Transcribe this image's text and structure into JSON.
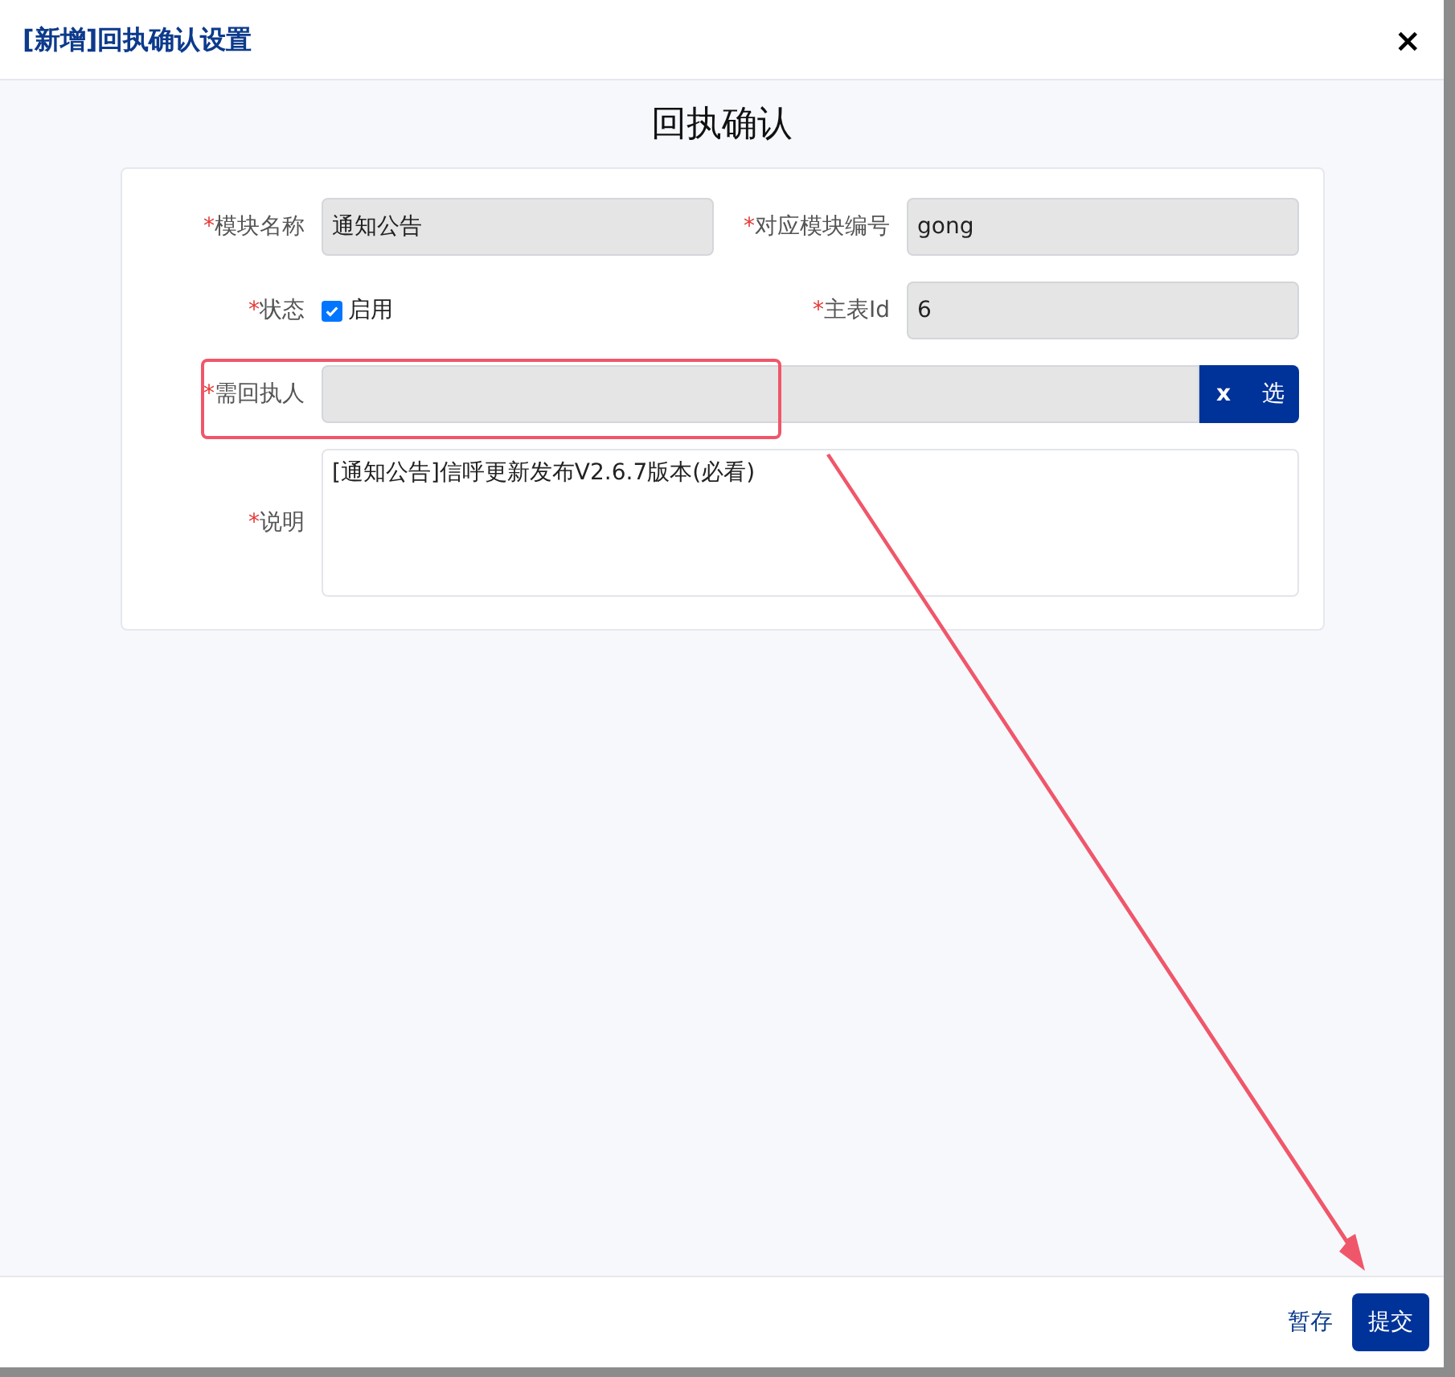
{
  "dialog": {
    "title": "[新增]回执确认设置",
    "close": "×"
  },
  "form": {
    "heading": "回执确认",
    "rows": [
      [
        {
          "kind": "input",
          "mark": "*",
          "label": "模块名称",
          "value": "通知公告"
        },
        {
          "kind": "input",
          "mark": "*",
          "label": "对应模块编号",
          "value": "gong"
        }
      ],
      [
        {
          "kind": "checkbox",
          "mark": "*",
          "label": "状态",
          "option": "启用",
          "checked": true
        },
        {
          "kind": "input",
          "mark": "*",
          "label": "主表Id",
          "value": "6"
        }
      ],
      [
        {
          "kind": "picker",
          "mark": "*",
          "label": "需回执人",
          "clear": "x",
          "choose": "选"
        }
      ],
      [
        {
          "kind": "textarea",
          "mark": "*",
          "label": "说明",
          "value": "[通知公告]信呼更新发布V2.6.7版本(必看)"
        }
      ]
    ]
  },
  "footer": {
    "buttons": [
      {
        "label": "暂存",
        "kind": "link"
      },
      {
        "label": "提交",
        "kind": "primary"
      }
    ]
  }
}
